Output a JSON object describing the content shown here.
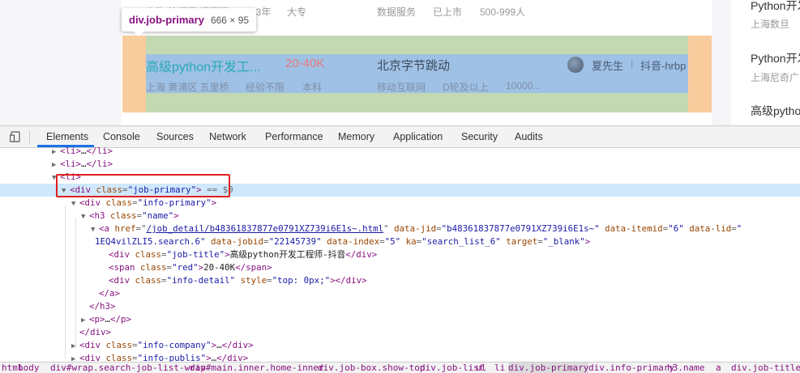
{
  "page": {
    "top_row": {
      "location": "上海 徐汇区 漕河泾",
      "experience": "1-3年",
      "education": "大专",
      "industry": "数据服务",
      "stage": "已上市",
      "size": "500-999人"
    },
    "job": {
      "title": "高级python开发工...",
      "salary": "20-40K",
      "company": "北京字节跳动",
      "recruiter_name": "夏先生",
      "recruiter_separator": "|",
      "recruiter_title": "抖音-hrbp",
      "location": "上海 黄浦区 五里桥",
      "experience": "经验不限",
      "education": "本科",
      "industry": "移动互联网",
      "stage": "D轮及以上",
      "size": "10000..."
    },
    "tooltip": {
      "element_name": "div.job-primary",
      "element_size": "666 × 95"
    },
    "sidebar": [
      {
        "title": "Python开发",
        "sub": "上海数旦"
      },
      {
        "title": "Python开发",
        "sub": "上海尼奇广"
      },
      {
        "title": "高级python",
        "sub": ""
      }
    ]
  },
  "devtools": {
    "tabs": [
      "Elements",
      "Console",
      "Sources",
      "Network",
      "Performance",
      "Memory",
      "Application",
      "Security",
      "Audits"
    ],
    "active_tab": "Elements",
    "dom_lines": {
      "l1": {
        "open": "<li>",
        "mid": "…",
        "close": "</li>"
      },
      "l2": {
        "open": "<li>",
        "mid": "…",
        "close": "</li>"
      },
      "l3": {
        "open": "<li>"
      },
      "l4": {
        "tag_open": "<div",
        "attr": "class",
        "val": "\"job-primary\"",
        "tag_close": ">",
        "suffix": " == $0"
      },
      "l5": {
        "tag_open": "<div",
        "attr": "class",
        "val": "\"info-primary\"",
        "tag_close": ">"
      },
      "l6": {
        "tag_open": "<h3",
        "attr": "class",
        "val": "\"name\"",
        "tag_close": ">"
      },
      "l7": {
        "tag_open": "<a",
        "href_attr": "href",
        "href_val": "/job_detail/b48361837877e0791XZ739i6E1s~.html",
        "a2": "data-jid",
        "v2": "\"b48361837877e0791XZ739i6E1s~\"",
        "a3": "data-itemid",
        "v3": "\"6\"",
        "a4": "data-lid",
        "v4_start": "\""
      },
      "l8": {
        "v4_end": "1EQ4vilZLI5.search.6\"",
        "a5": "data-jobid",
        "v5": "\"22145739\"",
        "a6": "data-index",
        "v6": "\"5\"",
        "a7": "ka",
        "v7": "\"search_list_6\"",
        "a8": "target",
        "v8": "\"_blank\"",
        "tag_close": ">"
      },
      "l9": {
        "tag_open": "<div",
        "attr": "class",
        "val": "\"job-title\"",
        "tag_close": ">",
        "text": "高级python开发工程师-抖音",
        "end": "</div>"
      },
      "l10": {
        "tag_open": "<span",
        "attr": "class",
        "val": "\"red\"",
        "tag_close": ">",
        "text": "20-40K",
        "end": "</span>"
      },
      "l11": {
        "tag_open": "<div",
        "attr": "class",
        "val": "\"info-detail\"",
        "attr2": "style",
        "val2": "\"top: 0px;\"",
        "tag_close": ">",
        "end": "</div>"
      },
      "l12": {
        "end": "</a>"
      },
      "l13": {
        "end": "</h3>"
      },
      "l14": {
        "open": "<p>",
        "mid": "…",
        "close": "</p>"
      },
      "l15": {
        "end": "</div>"
      },
      "l16": {
        "tag_open": "<div",
        "attr": "class",
        "val": "\"info-company\"",
        "tag_close": ">",
        "mid": "…",
        "end": "</div>"
      },
      "l17": {
        "tag_open": "<div",
        "attr": "class",
        "val": "\"info-publis\"",
        "tag_close": ">",
        "mid": "…",
        "end": "</div>"
      }
    },
    "breadcrumbs": [
      "html",
      "body",
      "div#wrap.search-job-list-wrap",
      "div#main.inner.home-inner",
      "div.job-box.show-top",
      "div.job-list",
      "ul",
      "li",
      "div.job-primary",
      "div.info-primary",
      "h3.name",
      "a",
      "div.job-title"
    ],
    "breadcrumb_active": "div.job-primary"
  },
  "colors": {
    "tag": "#881280",
    "attr": "#994500",
    "value": "#1a1aa6",
    "selected_row": "#cfe8fc",
    "highlight_box": "#e02020",
    "overlay_margin": "#f9cc9d",
    "overlay_padding": "#c3d9b1",
    "overlay_content": "#9fc1e5"
  }
}
